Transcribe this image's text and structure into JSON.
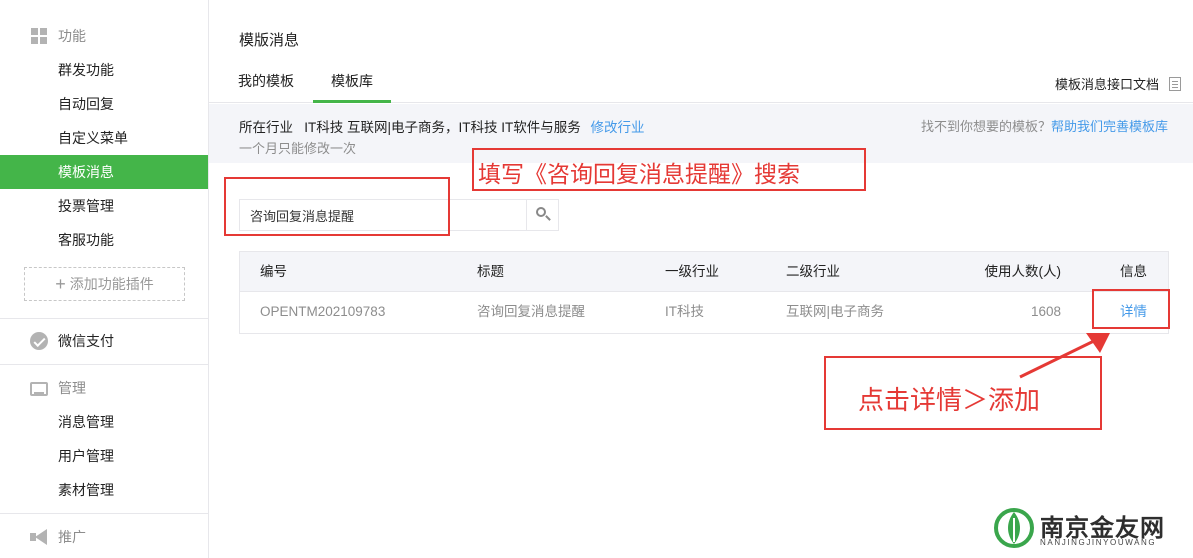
{
  "sidebar": {
    "sections": [
      {
        "label": "功能",
        "icon": "grid-icon"
      },
      {
        "label": "微信支付",
        "icon": "wechat-pay-icon"
      },
      {
        "label": "管理",
        "icon": "inbox-icon"
      },
      {
        "label": "推广",
        "icon": "megaphone-icon"
      }
    ],
    "function_items": [
      {
        "label": "群发功能"
      },
      {
        "label": "自动回复"
      },
      {
        "label": "自定义菜单"
      },
      {
        "label": "模板消息"
      },
      {
        "label": "投票管理"
      },
      {
        "label": "客服功能"
      }
    ],
    "add_plugin_label": "添加功能插件",
    "manage_items": [
      {
        "label": "消息管理"
      },
      {
        "label": "用户管理"
      },
      {
        "label": "素材管理"
      }
    ]
  },
  "main": {
    "title": "模版消息",
    "tabs": [
      {
        "label": "我的模板"
      },
      {
        "label": "模板库"
      }
    ],
    "doc_link": "模板消息接口文档",
    "industry": {
      "prefix": "所在行业",
      "primary": "IT科技 互联网|电子商务",
      "separator": "，",
      "secondary": "IT科技 IT软件与服务",
      "modify_link": "修改行业",
      "note": "一个月只能修改一次",
      "help_text": "找不到你想要的模板？",
      "help_link": "帮助我们完善模板库"
    },
    "search": {
      "value": "咨询回复消息提醒"
    },
    "table": {
      "headers": [
        "编号",
        "标题",
        "一级行业",
        "二级行业",
        "使用人数(人)",
        "信息"
      ],
      "rows": [
        {
          "id": "OPENTM202109783",
          "title": "咨询回复消息提醒",
          "industry1": "IT科技",
          "industry2": "互联网|电子商务",
          "users": "1608",
          "info": "详情"
        }
      ]
    }
  },
  "annotations": {
    "search_hint": "填写《咨询回复消息提醒》搜索",
    "click_hint": "点击详情＞添加",
    "color": "#e53935"
  },
  "watermark": {
    "title": "南京金友网",
    "subtitle": "NANJINGJINYOUWANG"
  },
  "colors": {
    "accent_green": "#44b549",
    "link_blue": "#459ae9",
    "bar_bg": "#f4f5f9"
  }
}
